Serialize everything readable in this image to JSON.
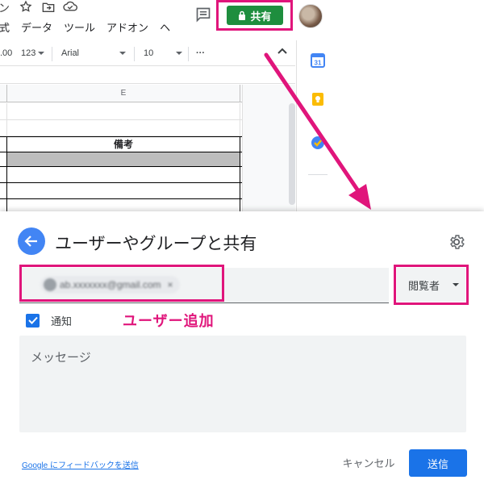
{
  "spreadsheet": {
    "title_icons": [
      "star-icon",
      "move-to-folder-icon",
      "cloud-status-icon"
    ],
    "title_fragment": "ン",
    "menus": [
      "式",
      "データ",
      "ツール",
      "アドオン",
      "ヘル"
    ],
    "toolbar": {
      "decimal": ".00",
      "number_format": "123",
      "font": "Arial",
      "font_size": "10",
      "more": "···"
    },
    "column_header": "E",
    "header_cell": "備考",
    "share_button_label": "共有"
  },
  "side_panel": {
    "icons": [
      "calendar-icon",
      "keep-icon",
      "tasks-icon"
    ],
    "calendar_day": "31"
  },
  "annotation": {
    "label": "ユーザー追加",
    "color": "#e0157b"
  },
  "dialog": {
    "title": "ユーザーやグループと共有",
    "email_chip": "ab.xxxxxxx@gmail.com",
    "role": "閲覧者",
    "notify_label": "通知",
    "notify_checked": true,
    "message_placeholder": "メッセージ",
    "feedback_link": "Google にフィードバックを送信",
    "cancel_label": "キャンセル",
    "send_label": "送信"
  },
  "colors": {
    "accent_blue": "#1a73e8",
    "share_green": "#1e8e3e",
    "highlight_pink": "#e0157b"
  }
}
